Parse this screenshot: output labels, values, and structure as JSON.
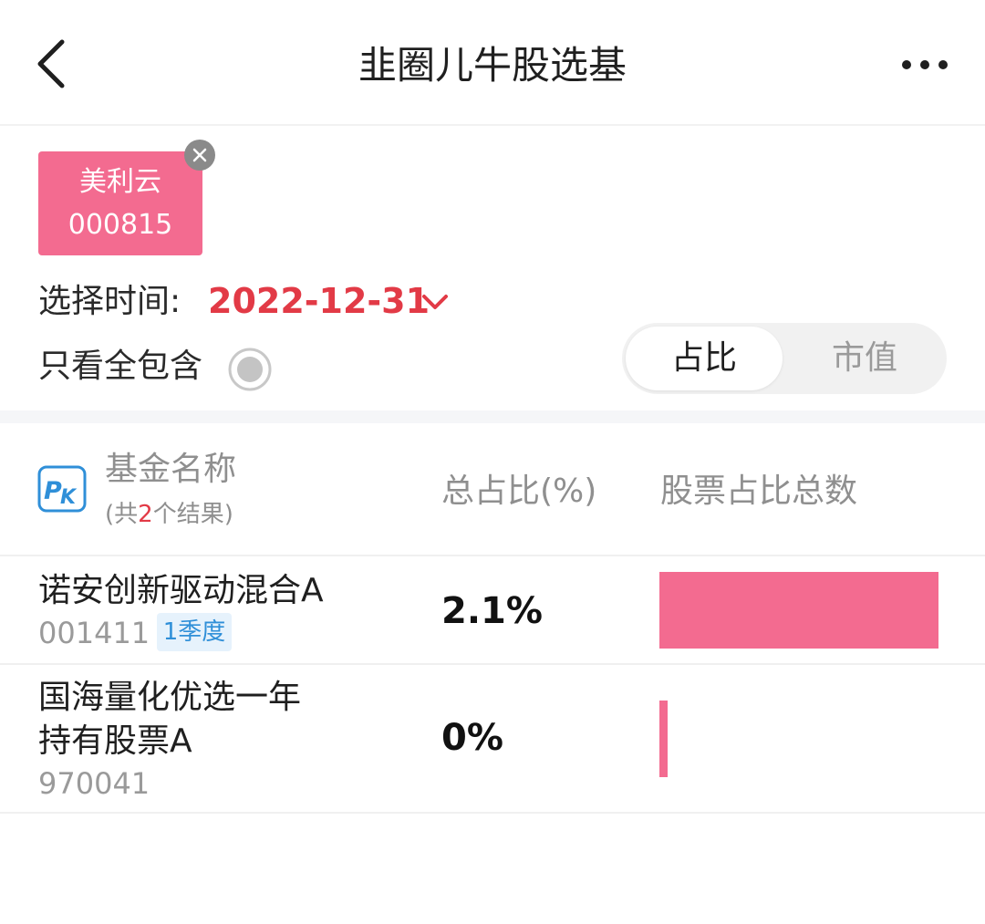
{
  "header": {
    "title": "韭圈儿牛股选基"
  },
  "selected_stock": {
    "name": "美利云",
    "code": "000815"
  },
  "filters": {
    "date_label": "选择时间:",
    "date_value": "2022-12-31",
    "full_contain_label": "只看全包含"
  },
  "toggle": {
    "options": [
      "占比",
      "市值"
    ],
    "active_index": 0
  },
  "table": {
    "headers": {
      "name": "基金名称",
      "count_prefix": "(共",
      "count": "2",
      "count_suffix": "个结果)",
      "total_pct": "总占比(%)",
      "stock_count": "股票占比总数"
    },
    "rows": [
      {
        "name_line1": "诺安创新驱动混合A",
        "name_line2": "",
        "code": "001411",
        "badge": "1季度",
        "total_pct": "2.1%",
        "bar_fraction": 1.0
      },
      {
        "name_line1": "国海量化优选一年",
        "name_line2": "持有股票A",
        "code": "970041",
        "badge": "",
        "total_pct": "0%",
        "bar_fraction": 0.03
      }
    ]
  },
  "colors": {
    "accent_pink": "#f36b90",
    "date_red": "#e23a46",
    "badge_blue": "#2f8fd8",
    "pk_blue": "#2f8fd8"
  },
  "icons": [
    "back-arrow-icon",
    "more-dots-icon",
    "close-icon",
    "chevron-down-icon",
    "radio-icon",
    "pk-icon"
  ]
}
